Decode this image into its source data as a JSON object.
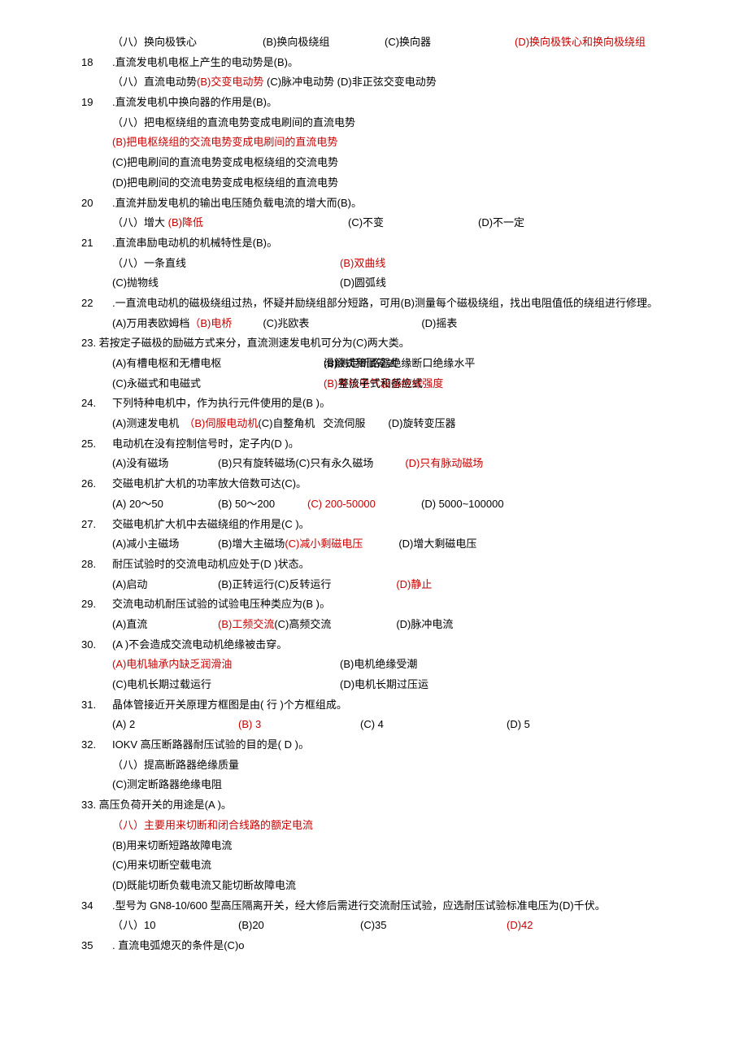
{
  "q17_opts": {
    "a": "（八）换向极铁心",
    "b": "(B)换向极绕组",
    "c": "(C)换向器",
    "d": "(D)换向极铁心和换向极绕组"
  },
  "q18": {
    "num": "18",
    "stem": ".直流发电机电枢上产生的电动势是(B)。",
    "a_pre": "（八）直流电动势",
    "b": "(B)交变电动势",
    "cd": "(C)脉冲电动势 (D)非正弦交变电动势"
  },
  "q19": {
    "num": "19",
    "stem": ".直流发电机中换向器的作用是(B)。",
    "a": "（八）把电枢绕组的直流电势变成电刷间的直流电势",
    "b": "(B)把电枢绕组的交流电势变成电刷间的直流电势",
    "c": "(C)把电刷间的直流电势变成电枢绕组的交流电势",
    "d": "(D)把电刷间的交流电势变成电枢绕组的直流电势"
  },
  "q20": {
    "num": "20",
    "stem": ".直流并励发电机的输出电压随负载电流的增大而(B)。",
    "a": "（八）增大 ",
    "b": "(B)降低",
    "c": "(C)不变",
    "d": "(D)不一定"
  },
  "q21": {
    "num": "21",
    "stem": ".直流串励电动机的机械特性是(B)₀",
    "a": "（八）一条直线",
    "b": "(B)双曲线",
    "c": "(C)抛物线",
    "d": "(D)圆弧线"
  },
  "q22": {
    "num": "22",
    "stem": " .一直流电动机的磁极绕组过热，怀疑并励绕组部分短路，可用(B)测量每个磁极绕组，找出电阻值低的绕组进行修理。",
    "a": "(A)万用表欧姆档",
    "b": "（B)电桥",
    "c": "(C)兆欧表",
    "d": "(D)摇表"
  },
  "q23": {
    "stem": "23. 若按定子磁极的励磁方式来分，直流测速发电机可分为(C)两大类。",
    "a": "(A)有槽电枢和无槽电枢",
    "c": "(C)永磁式和电磁式",
    "ov_b1": "(B)测定断路器",
    "ov_b2": "滑触式和鼠笼式",
    "ov_b2b": "绝缘断口绝缘水平",
    "ov_d1": "(B)考核电气设备绝缘强度",
    "ov_d2": "整流子式和感应式"
  },
  "q24": {
    "num": "24.",
    "stem": "下列特种电机中，作为执行元件使用的是(B )₀",
    "a": "(A)测速发电机",
    "b": "（B)伺服电动机",
    "c1": "(C)自整角机",
    "c2": "交流伺服",
    "d": "(D)旋转变压器"
  },
  "q25": {
    "num": "25.",
    "stem": "电动机在没有控制信号时，定子内(D )₀",
    "a": "(A)没有磁场",
    "b": "(B)只有旋转磁场",
    "c": "(C)只有永久磁场",
    "d": "(D)只有脉动磁场"
  },
  "q26": {
    "num": "26.",
    "stem": "交磁电机扩大机的功率放大倍数可达(C)。",
    "a": "(A)  20～50",
    "b": "(B)  50～200",
    "c": "(C) 200-50000",
    "d": "(D) 5000~100000"
  },
  "q27": {
    "num": "27.",
    "stem": "交磁电机扩大机中去磁绕组的作用是(C )。",
    "a": "(A)减小主磁场",
    "b": "(B)增大主磁场",
    "c": "(C)减小剩磁电压",
    "d": "(D)增大剩磁电压"
  },
  "q28": {
    "num": "28.",
    "stem": "耐压试验时的交流电动机应处于(D )状态。",
    "a": "(A)启动",
    "b": "(B)正转运行",
    "c": "(C)反转运行",
    "d": "(D)静止"
  },
  "q29": {
    "num": "29.",
    "stem": "交流电动机耐压试验的试验电压种类应为(B )₀",
    "a": "(A)直流",
    "b": "(B)工频交流",
    "c": "(C)高频交流",
    "d": "(D)脉冲电流"
  },
  "q30": {
    "num": "30.",
    "stem": " (A )不会造成交流电动机绝缘被击穿。",
    "a": "(A)电机轴承内缺乏润滑油",
    "b": "(B)电机绝缘受潮",
    "c": "(C)电机长期过载运行",
    "d": "(D)电机长期过压运"
  },
  "q31": {
    "num": "31.",
    "stem": "晶体管接近开关原理方框图是由(          行  )个方框组成。",
    "a": "(A) 2",
    "b": "(B) 3",
    "c": "(C)  4",
    "d": "(D) 5"
  },
  "q32": {
    "num": "32.",
    "stem": " IOKV 高压断路器耐压试验的目的是(   D )₀",
    "a": "（八）提高断路器绝缘质量",
    "c": "(C)测定断路器绝缘电阻"
  },
  "q33": {
    "stem": "33. 高压负荷开关的用途是(A )。",
    "a": "（八）主要用来切断和闭合线路的额定电流",
    "b": "(B)用来切断短路故障电流",
    "c": "(C)用来切断空载电流",
    "d": "(D)既能切断负载电流又能切断故障电流"
  },
  "q34": {
    "num": "34",
    "stem": " .型号为 GN8-10/600 型高压隔离开关，经大修后需进行交流耐压试验，应选耐压试验标准电压为(D)千伏。",
    "a": "（八）10",
    "b": "(B)20",
    "c": "(C)35",
    "d": "(D)42"
  },
  "q35": {
    "num": "35",
    "stem": " . 直流电弧熄灭的条件是(C)o"
  }
}
